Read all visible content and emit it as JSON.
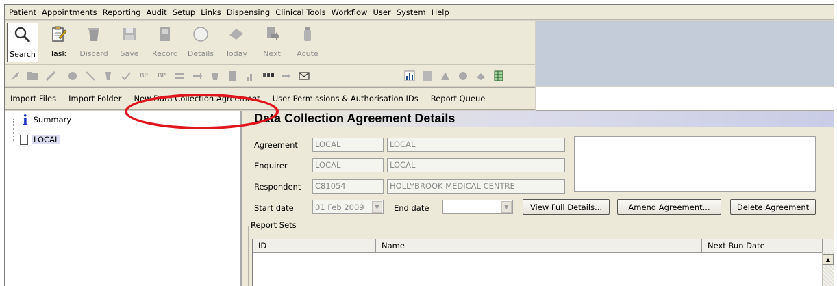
{
  "menubar": {
    "items": [
      "Patient",
      "Appointments",
      "Reporting",
      "Audit",
      "Setup",
      "Links",
      "Dispensing",
      "Clinical Tools",
      "Workflow",
      "User",
      "System",
      "Help"
    ]
  },
  "toolbar": {
    "big_buttons": [
      {
        "label": "Search",
        "icon": "magnifier-icon",
        "enabled": true,
        "active": true
      },
      {
        "label": "Task",
        "icon": "clipboard-icon",
        "enabled": true
      },
      {
        "label": "Discard",
        "icon": "bin-icon",
        "enabled": false
      },
      {
        "label": "Save",
        "icon": "floppy-disk-icon",
        "enabled": false
      },
      {
        "label": "Record",
        "icon": "record-icon",
        "enabled": false
      },
      {
        "label": "Details",
        "icon": "circle-icon",
        "enabled": false
      },
      {
        "label": "Today",
        "icon": "diamond-icon",
        "enabled": false
      },
      {
        "label": "Next",
        "icon": "next-icon",
        "enabled": false
      },
      {
        "label": "Acute",
        "icon": "bottle-icon",
        "enabled": false
      }
    ],
    "small_bp_1": "BP",
    "small_bp_2": "BP"
  },
  "actionbar": {
    "items": [
      "Import Files",
      "Import Folder",
      "New Data Collection Agreement",
      "User Permissions & Authorisation IDs",
      "Report Queue"
    ]
  },
  "tree": {
    "summary": "Summary",
    "local": "LOCAL"
  },
  "panel": {
    "title": "Data Collection Agreement Details",
    "agreement_label": "Agreement",
    "agreement_code": "LOCAL",
    "agreement_name": "LOCAL",
    "enquirer_label": "Enquirer",
    "enquirer_code": "LOCAL",
    "enquirer_name": "LOCAL",
    "respondent_label": "Respondent",
    "respondent_code": "C81054",
    "respondent_name": "HOLLYBROOK MEDICAL CENTRE",
    "start_label": "Start date",
    "start_value": "01 Feb 2009",
    "end_label": "End date",
    "end_value": "",
    "view_button": "View Full Details...",
    "amend_button": "Amend Agreement...",
    "delete_button": "Delete Agreement",
    "report_sets_label": "Report Sets",
    "columns": {
      "id": "ID",
      "name": "Name",
      "next_run": "Next Run Date"
    }
  },
  "colors": {
    "highlight_ring": "#e0161e",
    "title_gradient_end": "#c9cce6",
    "toolbar_right": "#c5ccd9"
  }
}
